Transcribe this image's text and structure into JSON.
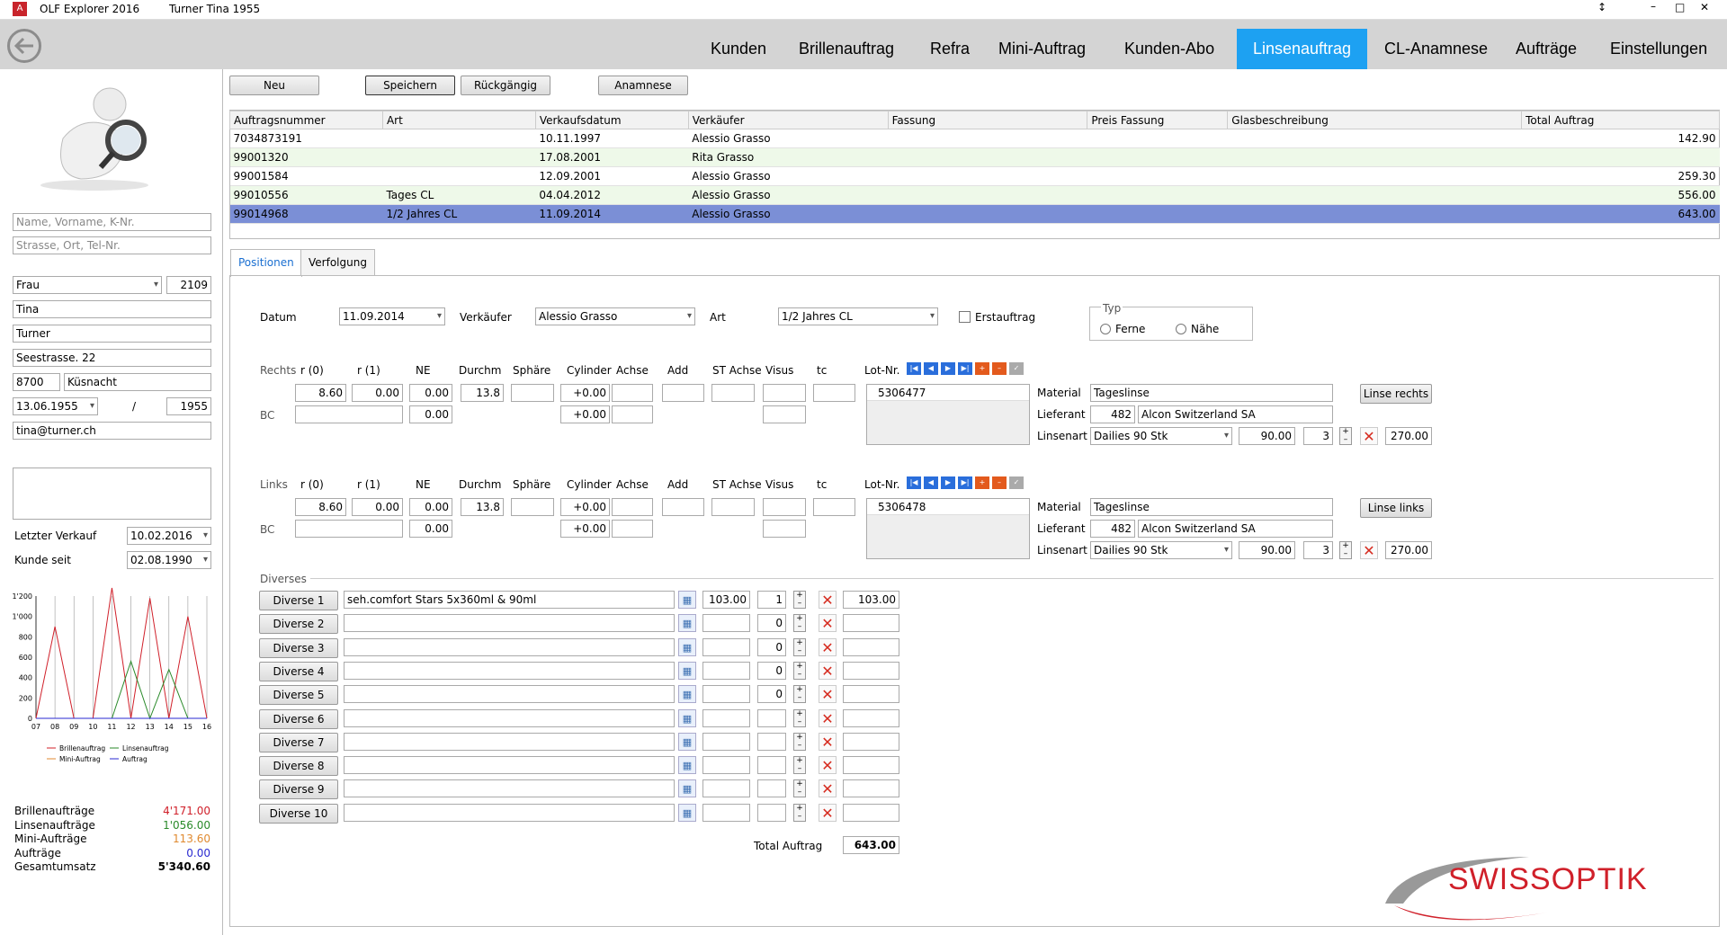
{
  "app": {
    "title": "OLF Explorer 2016",
    "customer": "Turner  Tina  1955"
  },
  "nav": [
    "Kunden",
    "Brillenauftrag",
    "Refra",
    "Mini-Auftrag",
    "Kunden-Abo",
    "Linsenauftrag",
    "CL-Anamnese",
    "Aufträge",
    "Einstellungen"
  ],
  "sidebar": {
    "search1_ph": "Name, Vorname, K-Nr.",
    "search2_ph": "Strasse, Ort, Tel-Nr.",
    "anrede": "Frau",
    "knr": "2109",
    "vorname": "Tina",
    "name": "Turner",
    "strasse": "Seestrasse. 22",
    "plz": "8700",
    "ort": "Küsnacht",
    "geburt": "13.06.1955",
    "slash": "/",
    "jahr": "1955",
    "email": "tina@turner.ch",
    "letzter_verkauf_label": "Letzter Verkauf",
    "letzter_verkauf": "10.02.2016",
    "kunde_seit_label": "Kunde seit",
    "kunde_seit": "02.08.1990",
    "stats": [
      {
        "label": "Brillenaufträge",
        "value": "4'171.00",
        "color": "#d0202a"
      },
      {
        "label": "Linsenaufträge",
        "value": "1'056.00",
        "color": "#2a8a2a"
      },
      {
        "label": "Mini-Aufträge",
        "value": "113.60",
        "color": "#e08a30"
      },
      {
        "label": "Aufträge",
        "value": "0.00",
        "color": "#2a2ad0"
      },
      {
        "label": "Gesamtumsatz",
        "value": "5'340.60",
        "color": "#000"
      }
    ]
  },
  "chart_data": {
    "type": "line",
    "x": [
      "07",
      "08",
      "09",
      "10",
      "11",
      "12",
      "13",
      "14",
      "15",
      "16"
    ],
    "ylim": [
      0,
      1200
    ],
    "yticks": [
      "0",
      "200",
      "400",
      "600",
      "800",
      "1'000",
      "1'200"
    ],
    "series": [
      {
        "name": "Brillenauftrag",
        "color": "#d0202a",
        "values": [
          0,
          900,
          0,
          0,
          1280,
          0,
          1180,
          0,
          1000,
          0
        ]
      },
      {
        "name": "Linsenauftrag",
        "color": "#2a8a2a",
        "values": [
          0,
          0,
          0,
          0,
          0,
          560,
          0,
          480,
          0,
          0
        ]
      },
      {
        "name": "Mini-Auftrag",
        "color": "#e08a30",
        "values": [
          0,
          0,
          0,
          0,
          0,
          0,
          0,
          0,
          0,
          0
        ]
      },
      {
        "name": "Auftrag",
        "color": "#2a2ad0",
        "values": [
          0,
          0,
          0,
          0,
          0,
          0,
          0,
          0,
          0,
          0
        ]
      }
    ]
  },
  "toolbar": {
    "neu": "Neu",
    "speichern": "Speichern",
    "rueckgaengig": "Rückgängig",
    "anamnese": "Anamnese"
  },
  "table": {
    "headers": [
      "Auftragsnummer",
      "Art",
      "Verkaufsdatum",
      "Verkäufer",
      "Fassung",
      "Preis Fassung",
      "Glasbeschreibung",
      "Total Auftrag"
    ],
    "rows": [
      [
        "7034873191",
        "",
        "10.11.1997",
        "Alessio Grasso",
        "",
        "",
        "",
        "142.90"
      ],
      [
        "99001320",
        "",
        "17.08.2001",
        "Rita Grasso",
        "",
        "",
        "",
        ""
      ],
      [
        "99001584",
        "",
        "12.09.2001",
        "Alessio Grasso",
        "",
        "",
        "",
        "259.30"
      ],
      [
        "99010556",
        "Tages CL",
        "04.04.2012",
        "Alessio Grasso",
        "",
        "",
        "",
        "556.00"
      ],
      [
        "99014968",
        "1/2 Jahres CL",
        "11.09.2014",
        "Alessio Grasso",
        "",
        "",
        "",
        "643.00"
      ]
    ]
  },
  "tabs": [
    "Positionen",
    "Verfolgung"
  ],
  "form": {
    "datum_label": "Datum",
    "datum": "11.09.2014",
    "verkaeufer_label": "Verkäufer",
    "verkaeufer": "Alessio Grasso",
    "art_label": "Art",
    "art": "1/2 Jahres CL",
    "erstauftrag": "Erstauftrag",
    "typ": "Typ",
    "ferne": "Ferne",
    "naehe": "Nähe"
  },
  "rx_headers": [
    "r (0)",
    "r (1)",
    "NE",
    "Durchm",
    "Sphäre",
    "Cylinder",
    "Achse",
    "Add",
    "ST Achse",
    "Visus",
    "tc",
    "Lot-Nr."
  ],
  "right": {
    "label": "Rechts",
    "bc": "BC",
    "r0": "8.60",
    "r1": "0.00",
    "ne": "0.00",
    "durchm": "13.8",
    "cyl": "+0.00",
    "bc_ne": "0.00",
    "bc_cyl": "+0.00",
    "lot": "5306477",
    "material_label": "Material",
    "material": "Tageslinse",
    "lieferant_label": "Lieferant",
    "lieferant_nr": "482",
    "lieferant": "Alcon Switzerland SA",
    "linsenart_label": "Linsenart",
    "linsenart": "Dailies 90 Stk",
    "preis": "90.00",
    "qty": "3",
    "total": "270.00",
    "button": "Linse rechts"
  },
  "left": {
    "label": "Links",
    "bc": "BC",
    "r0": "8.60",
    "r1": "0.00",
    "ne": "0.00",
    "durchm": "13.8",
    "cyl": "+0.00",
    "bc_ne": "0.00",
    "bc_cyl": "+0.00",
    "lot": "5306478",
    "material_label": "Material",
    "material": "Tageslinse",
    "lieferant_label": "Lieferant",
    "lieferant_nr": "482",
    "lieferant": "Alcon Switzerland SA",
    "linsenart_label": "Linsenart",
    "linsenart": "Dailies 90 Stk",
    "preis": "90.00",
    "qty": "3",
    "total": "270.00",
    "button": "Linse links"
  },
  "diverses": {
    "label": "Diverses",
    "rows": [
      {
        "btn": "Diverse 1",
        "text": "seh.comfort Stars 5x360ml & 90ml",
        "price": "103.00",
        "qty": "1",
        "total": "103.00"
      },
      {
        "btn": "Diverse 2",
        "text": "",
        "price": "",
        "qty": "0",
        "total": ""
      },
      {
        "btn": "Diverse 3",
        "text": "",
        "price": "",
        "qty": "0",
        "total": ""
      },
      {
        "btn": "Diverse 4",
        "text": "",
        "price": "",
        "qty": "0",
        "total": ""
      },
      {
        "btn": "Diverse 5",
        "text": "",
        "price": "",
        "qty": "0",
        "total": ""
      },
      {
        "btn": "Diverse 6",
        "text": "",
        "price": "",
        "qty": "",
        "total": ""
      },
      {
        "btn": "Diverse 7",
        "text": "",
        "price": "",
        "qty": "",
        "total": ""
      },
      {
        "btn": "Diverse 8",
        "text": "",
        "price": "",
        "qty": "",
        "total": ""
      },
      {
        "btn": "Diverse 9",
        "text": "",
        "price": "",
        "qty": "",
        "total": ""
      },
      {
        "btn": "Diverse 10",
        "text": "",
        "price": "",
        "qty": "",
        "total": ""
      }
    ],
    "total_label": "Total Auftrag",
    "total": "643.00"
  },
  "logo": "SWISSOPTIK"
}
